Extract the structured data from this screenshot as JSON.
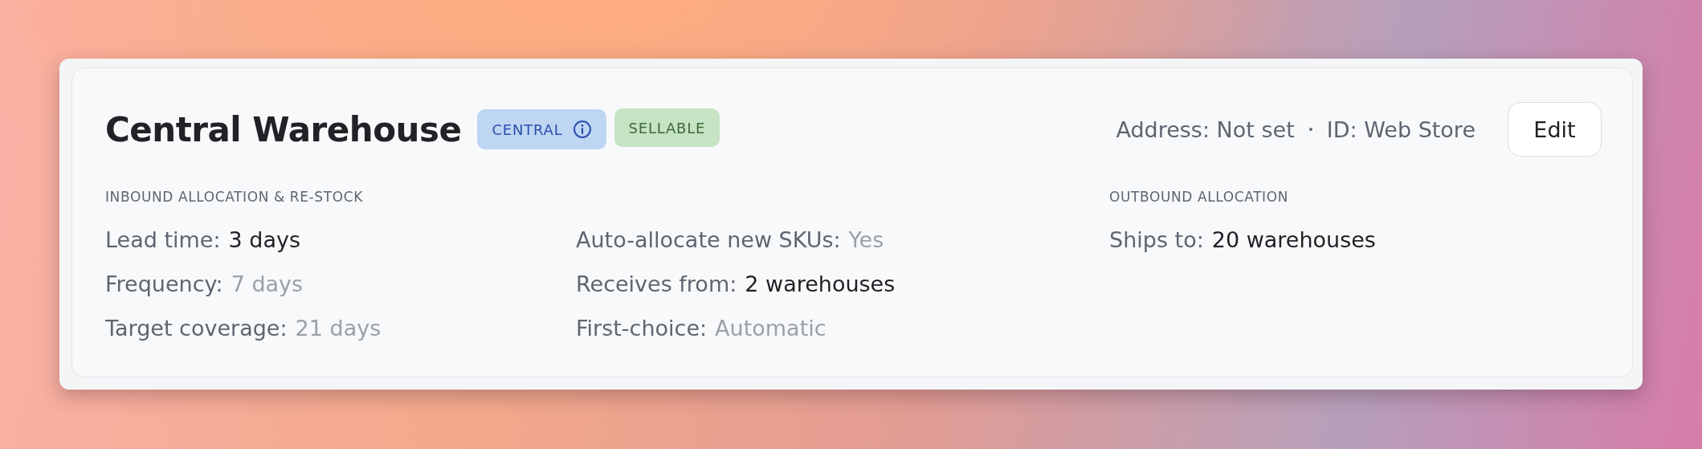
{
  "card": {
    "title": "Central Warehouse",
    "badges": [
      {
        "label": "CENTRAL",
        "kind": "info",
        "info_icon": true
      },
      {
        "label": "SELLABLE",
        "kind": "success",
        "info_icon": false
      }
    ],
    "meta": [
      "Address: Not set",
      "ID: Web Store"
    ],
    "edit_button": "Edit",
    "sections": [
      {
        "heading": "INBOUND ALLOCATION & RE-STOCK",
        "items": [
          {
            "label": "Lead time:",
            "value": "3 days",
            "muted": false
          },
          {
            "label": "Frequency:",
            "value": "7 days",
            "muted": true
          },
          {
            "label": "Target coverage:",
            "value": "21 days",
            "muted": true
          },
          {
            "label": "Auto-allocate new SKUs:",
            "value": "Yes",
            "muted": true
          },
          {
            "label": "Receives from:",
            "value": "2 warehouses",
            "muted": false
          },
          {
            "label": "First-choice:",
            "value": "Automatic",
            "muted": true
          }
        ]
      },
      {
        "heading": "OUTBOUND ALLOCATION",
        "items": [
          {
            "label": "Ships to:",
            "value": "20 warehouses",
            "muted": false
          }
        ]
      }
    ]
  }
}
